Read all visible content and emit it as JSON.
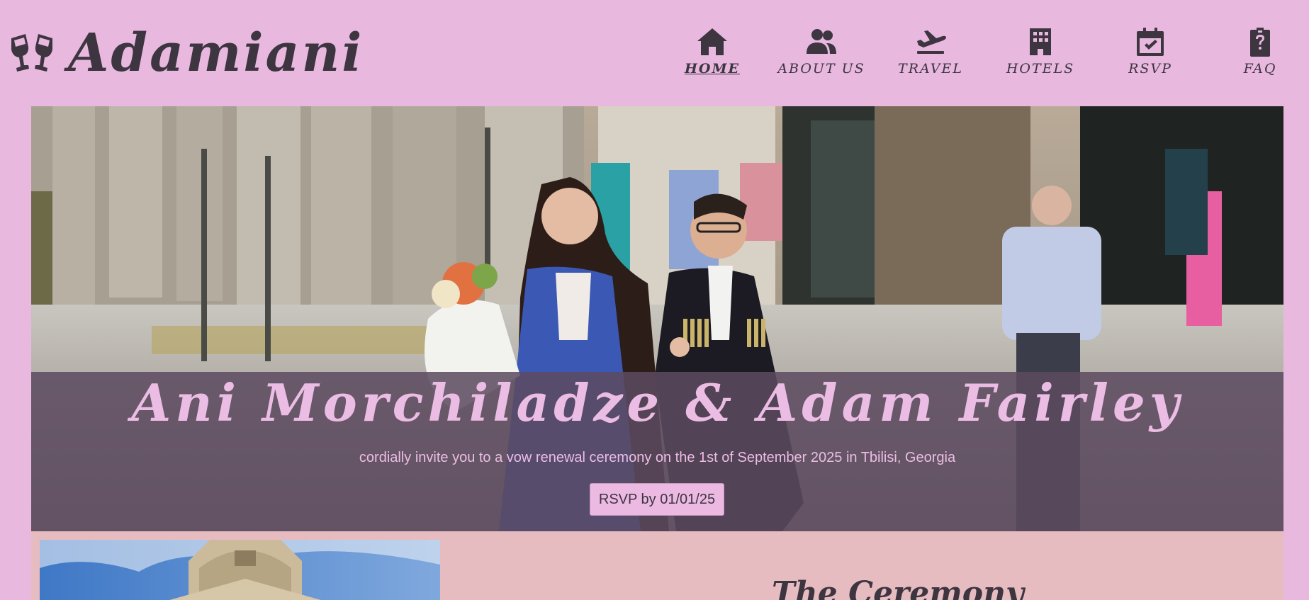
{
  "brand": {
    "name": "Adamiani",
    "icon": "champagne-glasses-icon"
  },
  "nav": {
    "items": [
      {
        "label": "HOME",
        "icon": "home-icon",
        "active": true
      },
      {
        "label": "ABOUT US",
        "icon": "users-icon",
        "active": false
      },
      {
        "label": "TRAVEL",
        "icon": "plane-icon",
        "active": false
      },
      {
        "label": "HOTELS",
        "icon": "hotel-icon",
        "active": false
      },
      {
        "label": "RSVP",
        "icon": "calendar-check-icon",
        "active": false
      },
      {
        "label": "FAQ",
        "icon": "question-clipboard-icon",
        "active": false
      }
    ]
  },
  "hero": {
    "names": "Ani Morchiladze & Adam Fairley",
    "invite": "cordially invite you to a vow renewal ceremony on the 1st of September 2025 in Tbilisi, Georgia",
    "rsvp_button": "RSVP by 01/01/25"
  },
  "ceremony": {
    "title": "The Ceremony"
  },
  "colors": {
    "background": "#e8b8df",
    "text_dark": "#3d3540",
    "hero_text": "#ecbde4",
    "overlay": "#5c4a5f",
    "section_bg": "#e7bcc0"
  }
}
